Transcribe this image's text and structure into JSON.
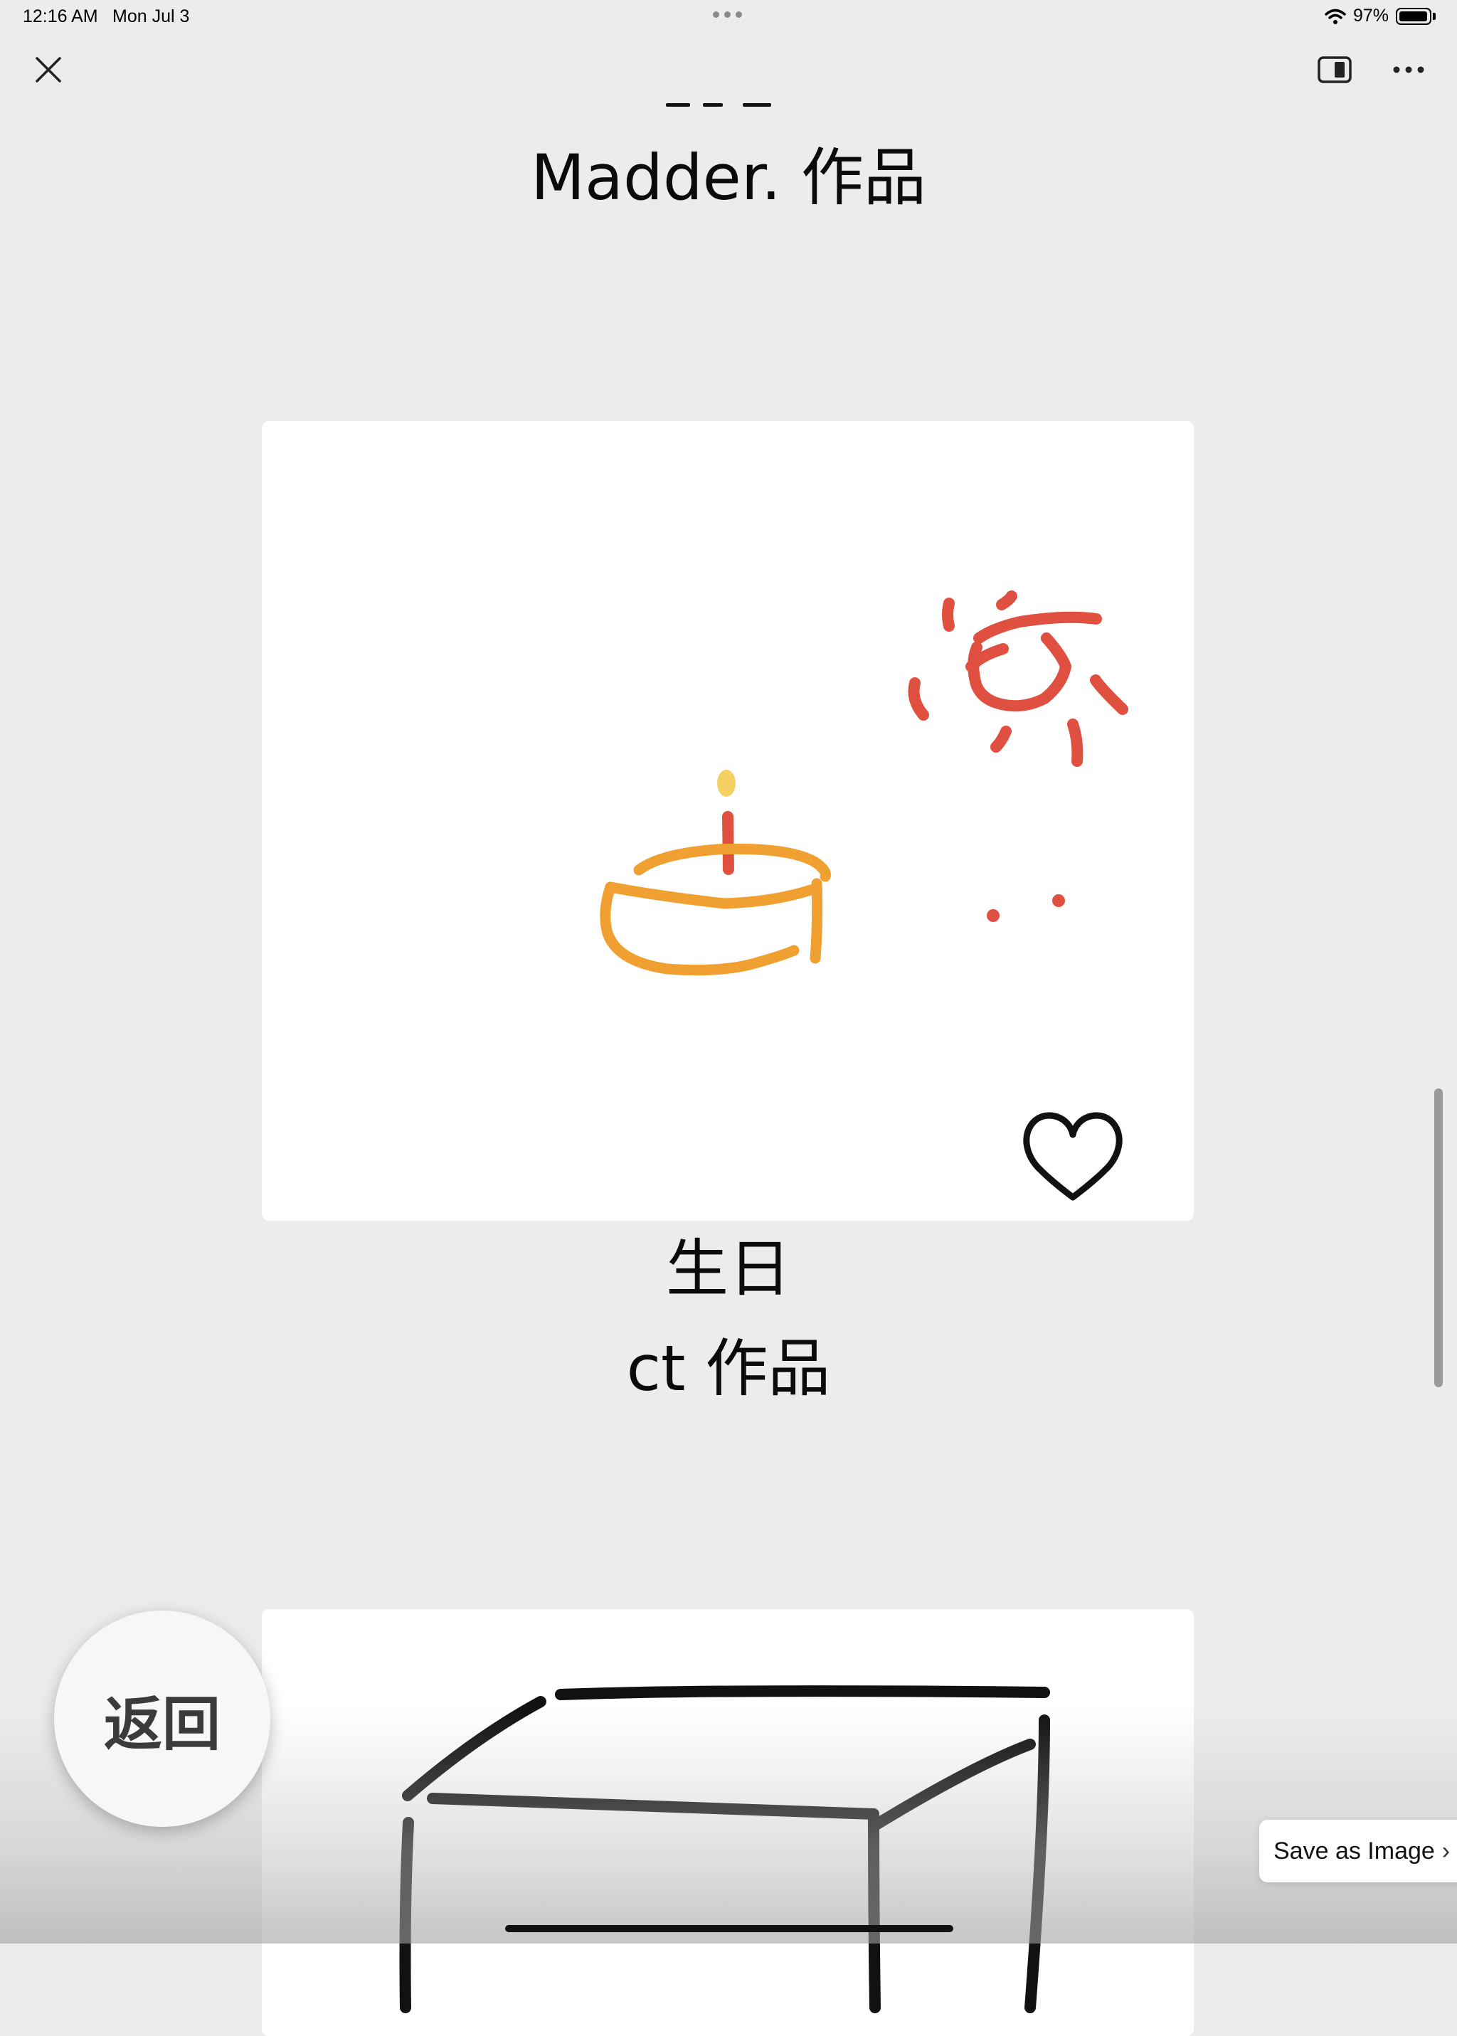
{
  "status_bar": {
    "time": "12:16 AM",
    "date": "Mon Jul 3",
    "battery": "97%",
    "battery_level": 0.97,
    "icons": [
      "wifi-icon",
      "battery-icon"
    ]
  },
  "toolbar": {
    "close_icon": "close-icon",
    "split_view_icon": "split-view-icon",
    "more_icon": "more-icon"
  },
  "gallery": {
    "previous_artist": "Madder. 作品",
    "artworks": [
      {
        "title": "生日",
        "artist": "ct 作品",
        "like_icon": "heart-outline-icon"
      }
    ]
  },
  "back_button": "返回",
  "save_button": {
    "label": "Save as Image",
    "icon": "chevron-right-icon"
  },
  "colors": {
    "background": "#ececec",
    "card": "#ffffff",
    "cake": "#f0a030",
    "candle": "#e05040",
    "flame": "#f5d060",
    "sun": "#e05040"
  }
}
